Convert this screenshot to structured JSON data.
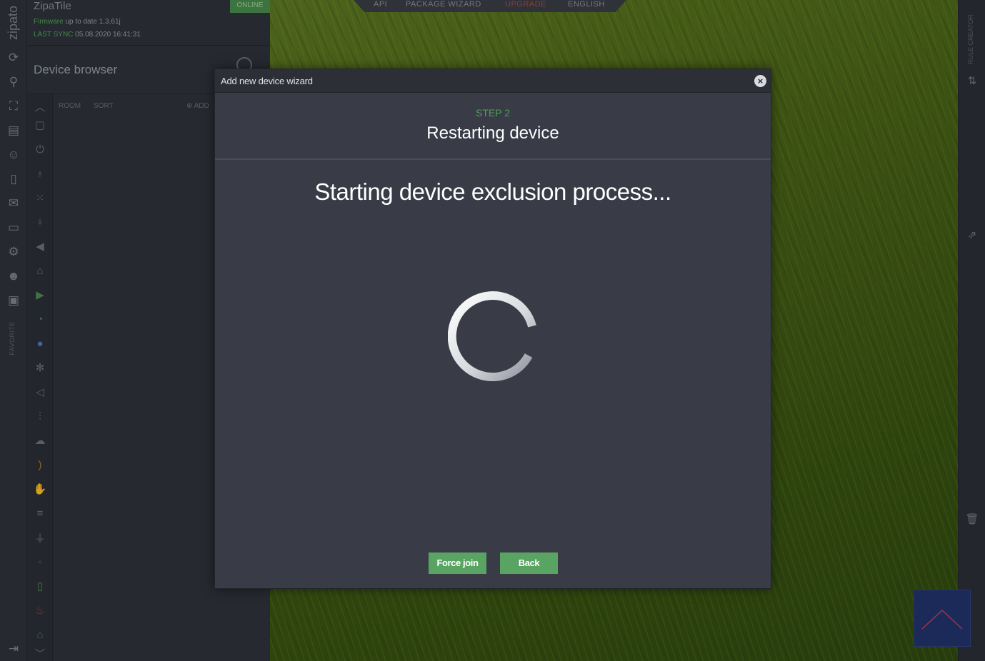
{
  "app": {
    "logo": "zipato",
    "title": "ZipaTile",
    "status": "ONLINE",
    "firmware_label": "Firmware",
    "firmware_value": "up to date 1.3.61j",
    "last_sync_label": "LAST SYNC",
    "last_sync_value": "05.08.2020 16:41:31"
  },
  "top_menu": [
    "API",
    "PACKAGE WIZARD",
    "UPGRADE",
    "ENGLISH"
  ],
  "colors": {
    "upgrade": "#c0392b",
    "accent": "#5aa463",
    "step": "#4e9f55",
    "online": "#4a8e4e"
  },
  "left_nav": {
    "favorite_label": "FAVORITE",
    "icons": [
      "sync-icon",
      "search-icon",
      "expand-icon",
      "scenes-icon",
      "users-icon",
      "device-icon",
      "mail-icon",
      "folder-icon",
      "settings-icon",
      "contacts-icon",
      "clipboard-icon",
      "logout-icon"
    ]
  },
  "device_browser": {
    "title": "Device browser",
    "room_label": "ROOM",
    "sort_label": "SORT",
    "add_label": "ADD",
    "category_icons": [
      "chevron-up-icon",
      "tablet-icon",
      "power-icon",
      "bulb-icon",
      "grid-icon",
      "bulb-outline-icon",
      "speaker-mute-icon",
      "siren-icon",
      "camera-icon",
      "gauge-icon",
      "water-drop-icon",
      "fan-icon",
      "speaker-icon",
      "thermometer-icon",
      "weather-icon",
      "signal-icon",
      "hand-icon",
      "binary-icon",
      "plug-icon",
      "co2-icon",
      "door-icon",
      "flame-icon",
      "home-icon",
      "chevron-down-icon"
    ]
  },
  "right_rail": {
    "label": "RULE CREATOR",
    "icons": [
      "swap-icon",
      "external-link-icon",
      "trash-icon"
    ]
  },
  "modal": {
    "title": "Add new device wizard",
    "step": "STEP 2",
    "step_title": "Restarting device",
    "message": "Starting device exclusion process...",
    "buttons": {
      "force_join": "Force join",
      "back": "Back"
    }
  }
}
